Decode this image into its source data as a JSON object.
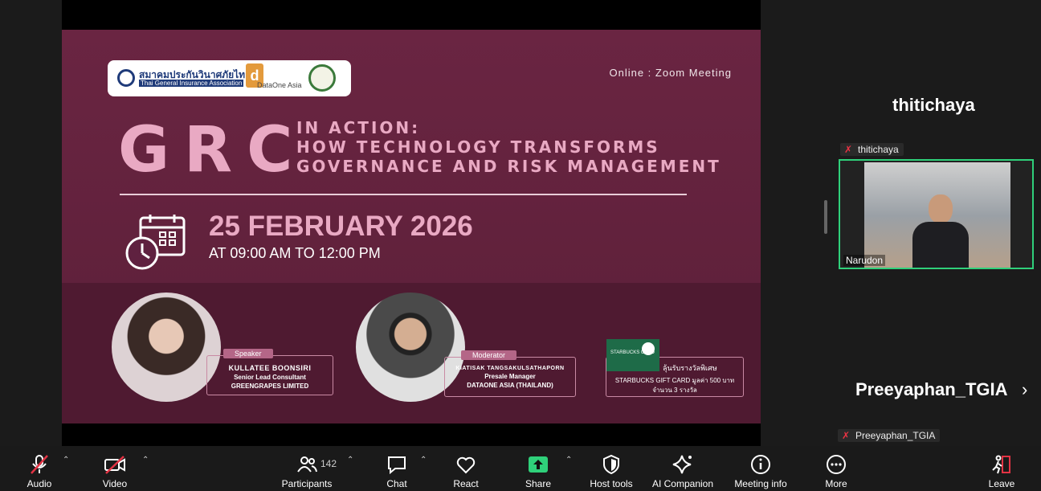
{
  "slide": {
    "logo1_line1": "สมาคมประกันวินาศภัยไทย",
    "logo1_line2": "Thai General Insurance Association",
    "logo2_text": "DataOne Asia",
    "online": "Online : Zoom Meeting",
    "grc": "GRC",
    "subtitle_line1": "IN ACTION:",
    "subtitle_line2": "HOW TECHNOLOGY TRANSFORMS",
    "subtitle_line3": "GOVERNANCE AND RISK MANAGEMENT",
    "date": "25 FEBRUARY 2026",
    "time": "AT 09:00 AM TO 12:00 PM",
    "speaker": {
      "tag": "Speaker",
      "name": "KULLATEE BOONSIRI",
      "role": "Senior Lead Consultant",
      "company": "GREENGRAPES LIMITED"
    },
    "moderator": {
      "tag": "Moderator",
      "name": "KIATISAK TANGSAKULSATHAPORN",
      "role": "Presale Manager",
      "company": "DATAONE ASIA (THAILAND)"
    },
    "prize": {
      "card_label": "STARBUCKS CARD",
      "line1": "ลุ้นรับรางวัลพิเศษ",
      "line2": "STARBUCKS GIFT CARD มูลค่า 500 บาท",
      "line3": "จำนวน 3 รางวัล"
    }
  },
  "participants_panel": {
    "big_name_1": "thitichaya",
    "label_1": "thitichaya",
    "video_name": "Narudon",
    "big_name_2": "Preeyaphan_TGIA",
    "label_2": "Preeyaphan_TGIA"
  },
  "toolbar": {
    "audio": "Audio",
    "video": "Video",
    "participants": "Participants",
    "participant_count": "142",
    "chat": "Chat",
    "react": "React",
    "share": "Share",
    "host_tools": "Host tools",
    "ai_companion": "AI Companion",
    "meeting_info": "Meeting info",
    "more": "More",
    "leave": "Leave"
  },
  "colors": {
    "accent_share": "#2fd07a",
    "mute": "#e33344",
    "slide_bg": "#6a2542",
    "slide_pink": "#e9a9c3"
  }
}
